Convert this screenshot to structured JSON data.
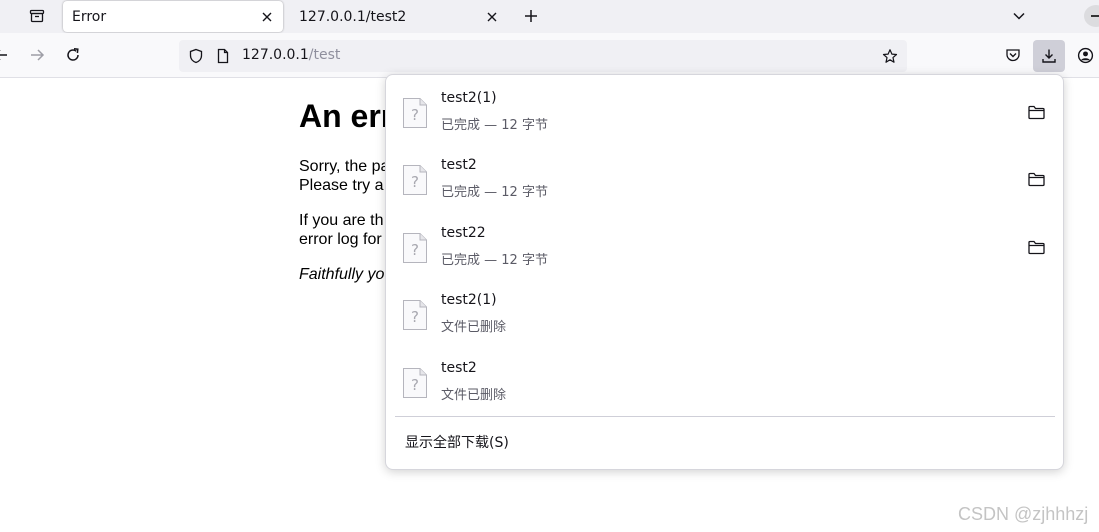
{
  "tabs": [
    {
      "label": "Error",
      "active": true
    },
    {
      "label": "127.0.0.1/test2",
      "active": false
    }
  ],
  "urlbar": {
    "host": "127.0.0.1",
    "path": "/test"
  },
  "page": {
    "heading": "An err",
    "para1_line1": "Sorry, the pa",
    "para1_line2": "Please try a",
    "para2_line1": "If you are th",
    "para2_line2": "error log for",
    "signature": "Faithfully yo"
  },
  "downloads": {
    "items": [
      {
        "name": "test2(1)",
        "status": "已完成 — 12 字节",
        "has_folder": true
      },
      {
        "name": "test2",
        "status": "已完成 — 12 字节",
        "has_folder": true
      },
      {
        "name": "test22",
        "status": "已完成 — 12 字节",
        "has_folder": true
      },
      {
        "name": "test2(1)",
        "status": "文件已删除",
        "has_folder": false
      },
      {
        "name": "test2",
        "status": "文件已删除",
        "has_folder": false
      }
    ],
    "show_all_label": "显示全部下载(S)"
  },
  "watermark": "CSDN @zjhhhzj",
  "icons": [
    "tab-list-icon",
    "close-icon",
    "plus-icon",
    "chevron-down-icon",
    "back-icon",
    "forward-icon",
    "reload-icon",
    "shield-icon",
    "page-icon",
    "star-icon",
    "pocket-icon",
    "download-icon",
    "account-icon",
    "unknown-file-icon",
    "folder-icon"
  ],
  "colors": {
    "tabstrip_bg": "#f0f0f4",
    "navbar_bg": "#f9f9fb",
    "urlbar_bg": "#f0f0f4",
    "url_path": "#8f8f9d",
    "downloads_btn_bg": "#cfcfd8",
    "status_text": "#5b5b66"
  }
}
